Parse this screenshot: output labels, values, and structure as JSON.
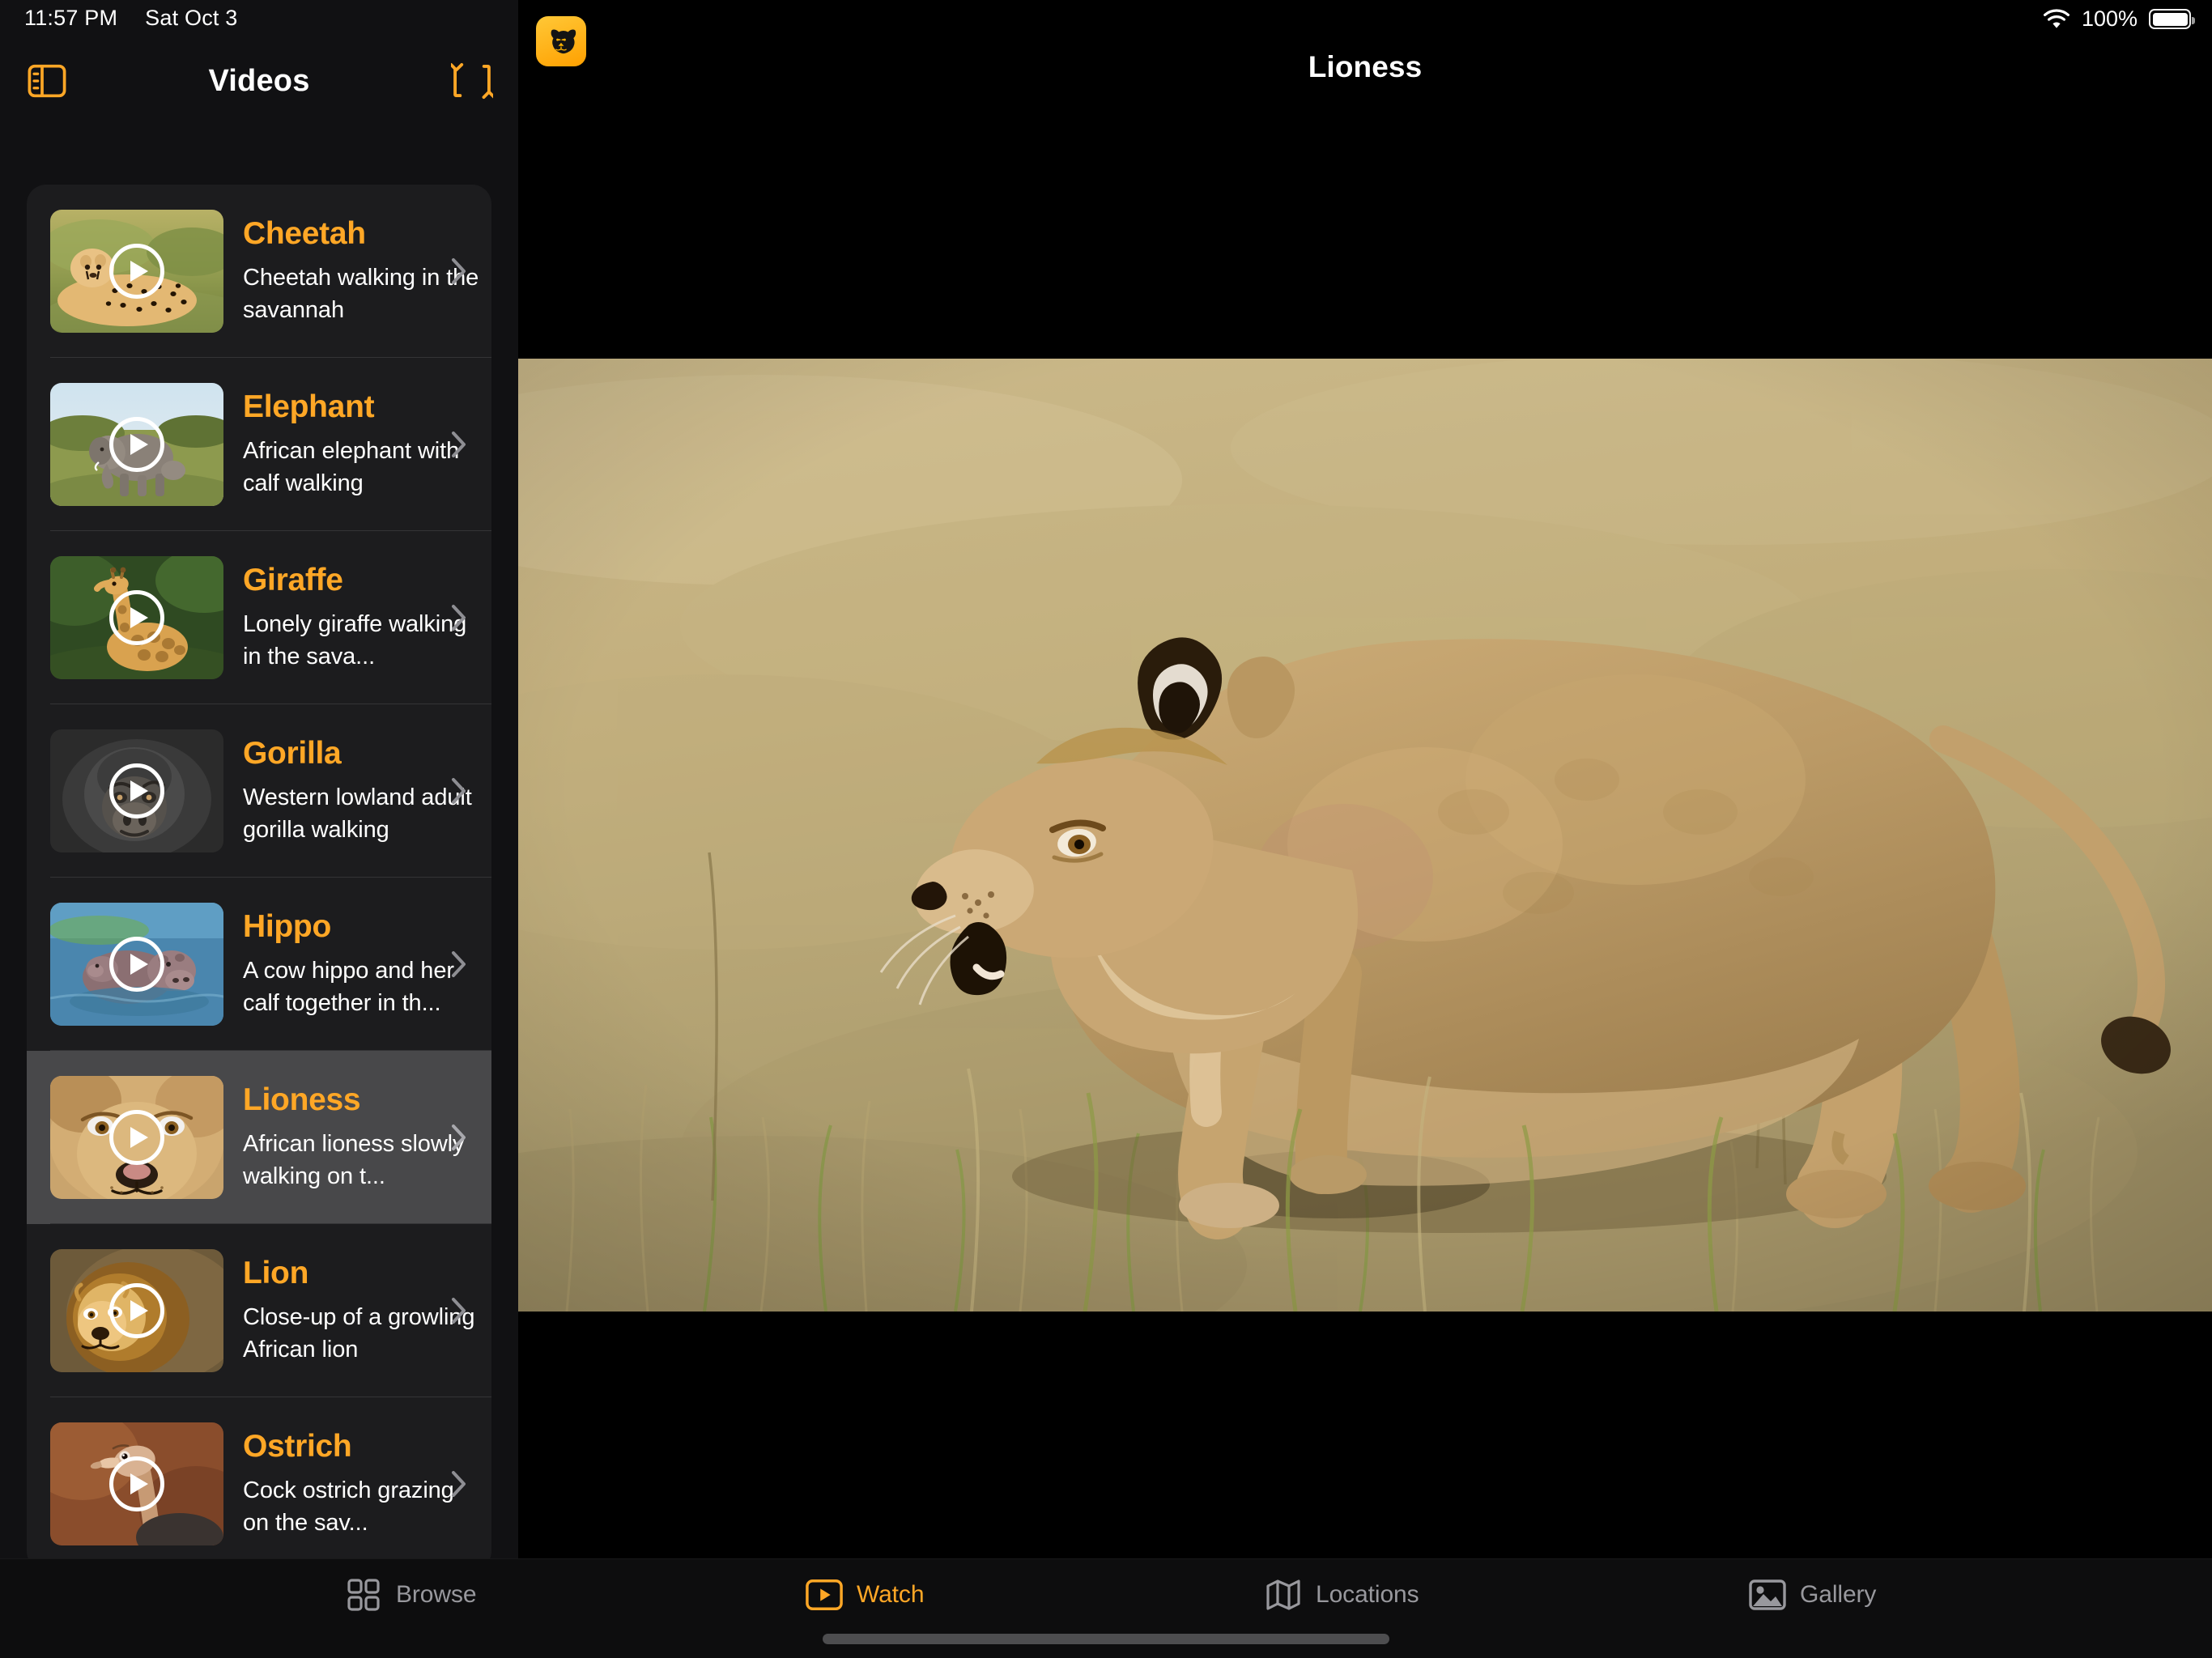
{
  "status_bar": {
    "time": "11:57 PM",
    "date": "Sat Oct 3",
    "battery_percent": "100%",
    "wifi_icon": "wifi-icon",
    "battery_icon": "battery-full-icon"
  },
  "sidebar": {
    "title": "Videos",
    "toggle_icon": "sidebar-toggle-icon",
    "refresh_icon": "refresh-arrows-icon",
    "items": [
      {
        "title": "Cheetah",
        "description": "Cheetah walking in the savannah",
        "selected": false,
        "thumb": "cheetah-thumbnail"
      },
      {
        "title": "Elephant",
        "description": "African elephant with calf walking",
        "selected": false,
        "thumb": "elephant-thumbnail"
      },
      {
        "title": "Giraffe",
        "description": "Lonely giraffe walking in the sava...",
        "selected": false,
        "thumb": "giraffe-thumbnail"
      },
      {
        "title": "Gorilla",
        "description": "Western lowland adult gorilla walking",
        "selected": false,
        "thumb": "gorilla-thumbnail"
      },
      {
        "title": "Hippo",
        "description": "A cow hippo and her calf together in th...",
        "selected": false,
        "thumb": "hippo-thumbnail"
      },
      {
        "title": "Lioness",
        "description": "African lioness slowly walking on t...",
        "selected": true,
        "thumb": "lioness-thumbnail"
      },
      {
        "title": "Lion",
        "description": "Close-up of a growling African lion",
        "selected": false,
        "thumb": "lion-thumbnail"
      },
      {
        "title": "Ostrich",
        "description": "Cock ostrich grazing on the sav...",
        "selected": false,
        "thumb": "ostrich-thumbnail"
      }
    ]
  },
  "detail": {
    "title": "Lioness",
    "app_badge_icon": "lion-face-badge-icon",
    "video_player_name": "lioness-video-player"
  },
  "tab_bar": {
    "tabs": [
      {
        "label": "Browse",
        "icon": "grid-icon",
        "active": false
      },
      {
        "label": "Watch",
        "icon": "play-rect-icon",
        "active": true
      },
      {
        "label": "Locations",
        "icon": "map-icon",
        "active": false
      },
      {
        "label": "Gallery",
        "icon": "photo-icon",
        "active": false
      }
    ]
  },
  "colors": {
    "accent": "#FFA726",
    "sidebar_bg": "#111113",
    "card_bg": "#1c1c1e",
    "selected_row_bg": "#48484a",
    "tab_inactive": "#98989d"
  }
}
